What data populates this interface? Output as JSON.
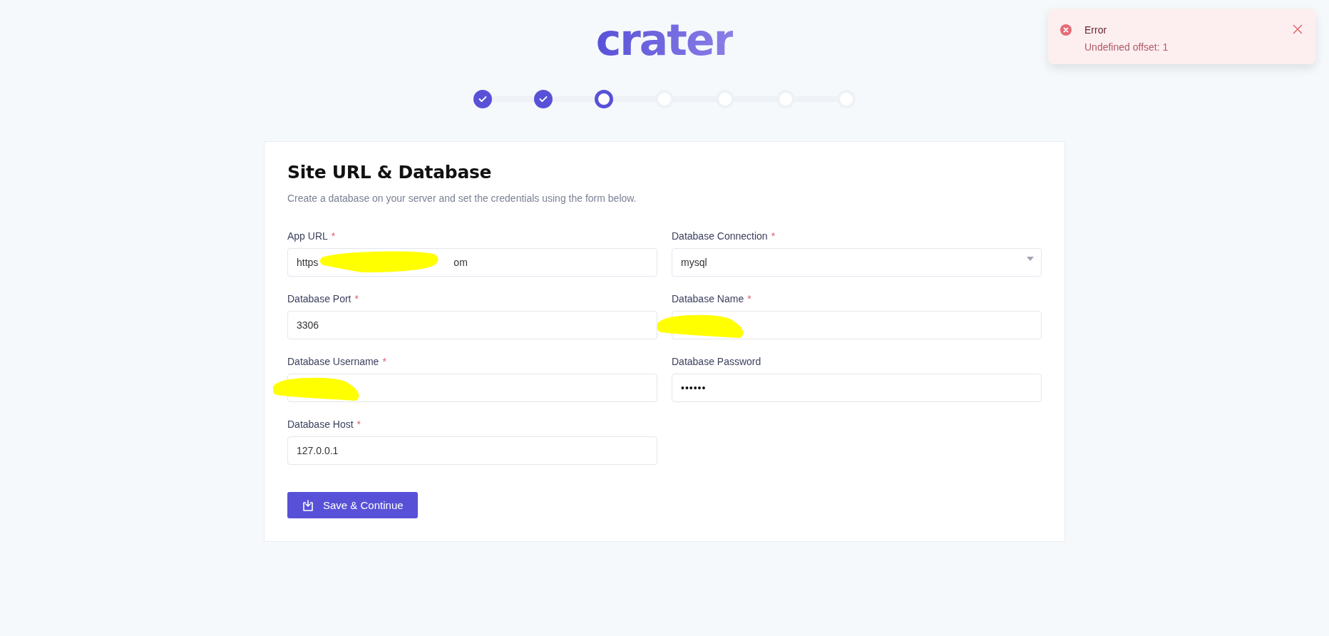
{
  "logo": {
    "text": "crater"
  },
  "steps": [
    {
      "kind": "done"
    },
    {
      "kind": "done"
    },
    {
      "kind": "current"
    },
    {
      "kind": "pending"
    },
    {
      "kind": "pending"
    },
    {
      "kind": "pending"
    },
    {
      "kind": "pending"
    }
  ],
  "toast": {
    "title": "Error",
    "message": "Undefined offset: 1"
  },
  "card": {
    "title": "Site URL & Database",
    "subtitle": "Create a database on your server and set the credentials using the form below."
  },
  "fields": [
    {
      "label": "App URL",
      "required_mark": "*",
      "kind": "text",
      "value": "https",
      "value_end": "om",
      "redacted": true
    },
    {
      "label": "Database Connection",
      "required_mark": "*",
      "kind": "select",
      "value": "mysql"
    },
    {
      "label": "Database Port",
      "required_mark": "*",
      "kind": "text",
      "value": "3306"
    },
    {
      "label": "Database Name",
      "required_mark": "*",
      "kind": "text",
      "redacted": true
    },
    {
      "label": "Database Username",
      "required_mark": "*",
      "kind": "text",
      "redacted": true
    },
    {
      "label": "Database Password",
      "kind": "password",
      "value": "••••••"
    },
    {
      "label": "Database Host",
      "required_mark": "*",
      "kind": "text",
      "value": "127.0.0.1"
    }
  ],
  "button": {
    "label": "Save & Continue"
  }
}
